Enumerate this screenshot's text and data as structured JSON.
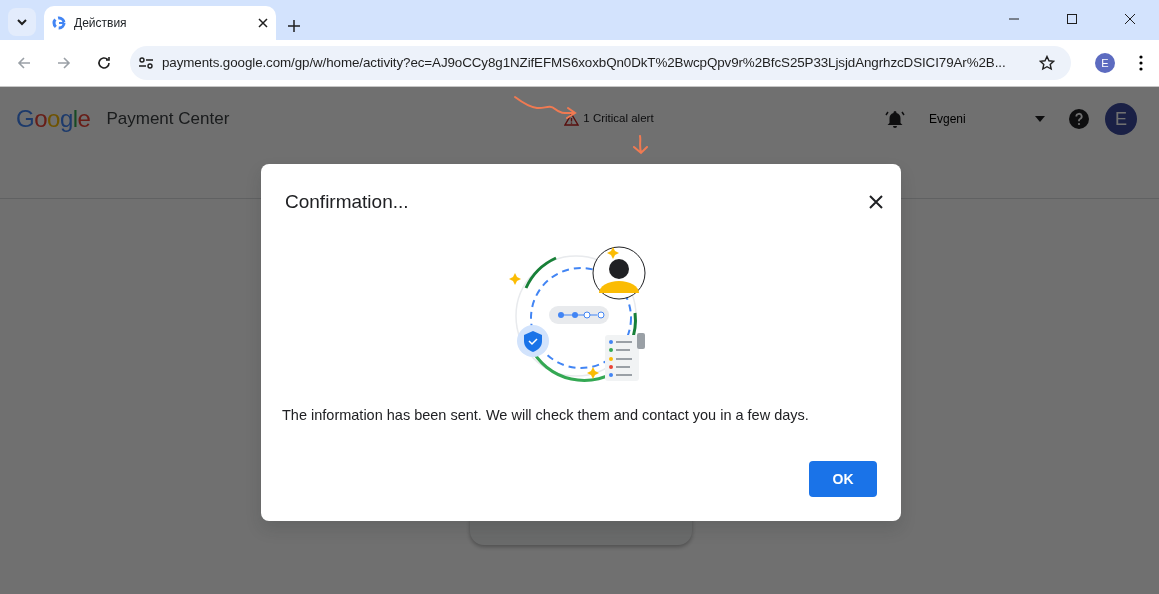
{
  "browser": {
    "tab_title": "Действия",
    "url": "payments.google.com/gp/w/home/activity?ec=AJ9oCCy8g1NZifEFMS6xoxbQn0DkT%2BwcpQpv9r%2BfcS25P33LjsjdAngrhzcDSICI79Ar%2B...",
    "profile_initial": "E"
  },
  "app_header": {
    "logo": "Google",
    "product": "Payment Center",
    "alert": "1 Critical alert",
    "user_name": "Evgeni",
    "avatar_initial": "E"
  },
  "dialog": {
    "title": "Confirmation...",
    "message": "The information has been sent. We will check them and contact you in a few days.",
    "buttons": [
      "OK"
    ]
  }
}
